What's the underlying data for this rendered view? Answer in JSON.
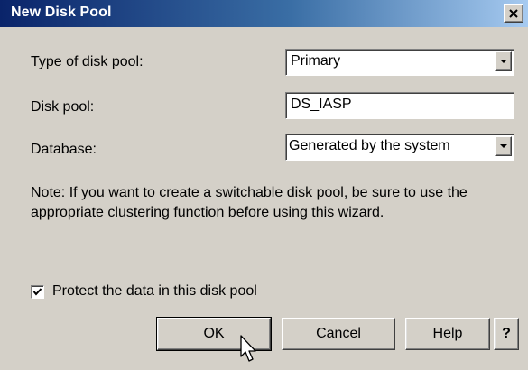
{
  "window": {
    "title": "New Disk Pool",
    "close_symbol": "✕"
  },
  "form": {
    "type_label": "Type of disk pool:",
    "type_value": "Primary",
    "pool_label": "Disk pool:",
    "pool_value": "DS_IASP",
    "db_label": "Database:",
    "db_value": "Generated by the system"
  },
  "note": "Note:  If you want to create a switchable disk pool, be sure to use the appropriate clustering function before using this wizard.",
  "protect": {
    "label": "Protect the data in this disk pool",
    "checked": true
  },
  "buttons": {
    "ok": "OK",
    "cancel": "Cancel",
    "help": "Help",
    "whats_this": "?"
  },
  "icons": {
    "close": "close-icon",
    "dropdown": "chevron-down-icon",
    "check": "check-icon",
    "cursor": "mouse-pointer-icon"
  }
}
